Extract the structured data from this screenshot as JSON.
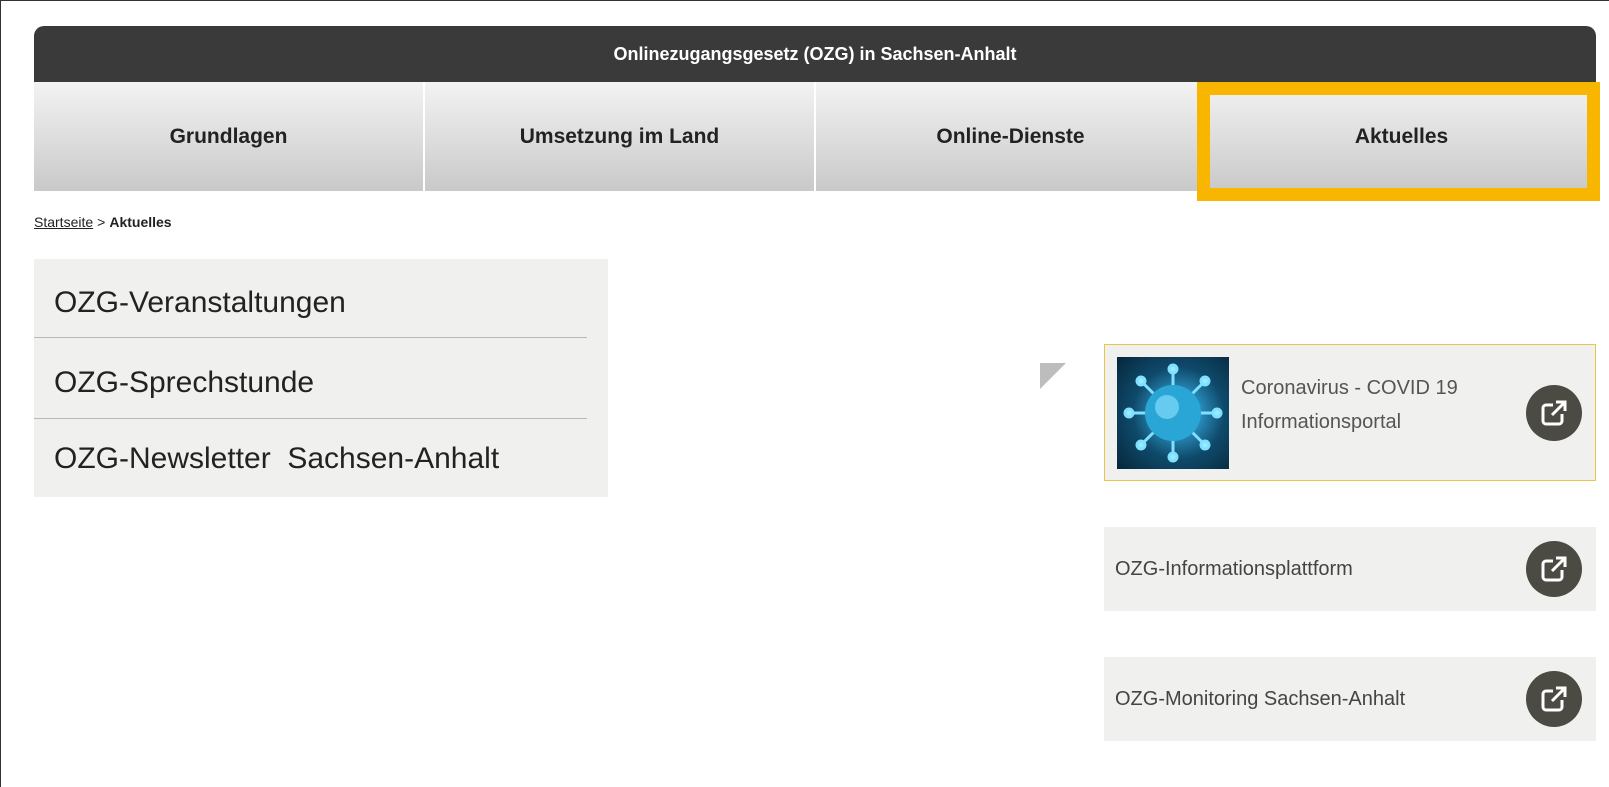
{
  "header": {
    "title": "Onlinezugangsgesetz (OZG) in Sachsen-Anhalt"
  },
  "nav": {
    "tabs": [
      {
        "label": "Grundlagen"
      },
      {
        "label": "Umsetzung im Land"
      },
      {
        "label": "Online-Dienste"
      },
      {
        "label": "Aktuelles"
      }
    ],
    "highlighted": "Aktuelles",
    "highlight_color": "#f8b600"
  },
  "breadcrumb": {
    "home": "Startseite",
    "separator": ">",
    "current": "Aktuelles"
  },
  "side_menu": {
    "items": [
      {
        "label": "OZG-Veranstaltungen"
      },
      {
        "label": "OZG-Sprechstunde"
      },
      {
        "label": "OZG-Newsletter  Sachsen-Anhalt"
      }
    ]
  },
  "links": {
    "covid": {
      "line1": "Coronavirus - COVID 19",
      "line2": "Informationsportal",
      "icon": "external-link-icon"
    },
    "plattform": {
      "label": "OZG-Informationsplattform",
      "icon": "external-link-icon"
    },
    "monitoring": {
      "label": "OZG-Monitoring Sachsen-Anhalt",
      "icon": "external-link-icon"
    }
  },
  "colors": {
    "header_bg": "#3a3a3a",
    "card_bg": "#f0f0ee",
    "icon_bg": "#4b4a43"
  }
}
